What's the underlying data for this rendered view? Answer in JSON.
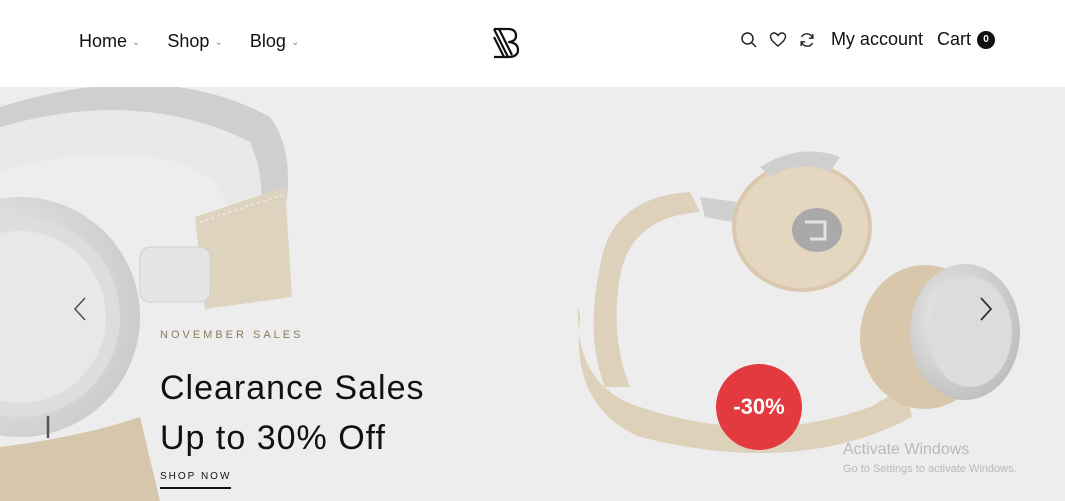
{
  "header": {
    "nav": [
      {
        "label": "Home"
      },
      {
        "label": "Shop"
      },
      {
        "label": "Blog"
      }
    ],
    "logo_icon": "brand-b-logo-icon",
    "actions": {
      "search_icon": "search-icon",
      "wishlist_icon": "heart-icon",
      "compare_icon": "refresh-icon",
      "account_label": "My account",
      "cart_label": "Cart",
      "cart_count": "0"
    }
  },
  "hero": {
    "eyebrow": "NOVEMBER SALES",
    "title_line1": "Clearance Sales",
    "title_line2": "Up to 30% Off",
    "cta_label": "SHOP NOW",
    "badge": "-30%",
    "prev_icon": "chevron-left-icon",
    "next_icon": "chevron-right-icon",
    "background_color": "#ededed",
    "badge_color": "#e23a3f"
  },
  "watermark": {
    "title": "Activate Windows",
    "subtitle": "Go to Settings to activate Windows."
  }
}
